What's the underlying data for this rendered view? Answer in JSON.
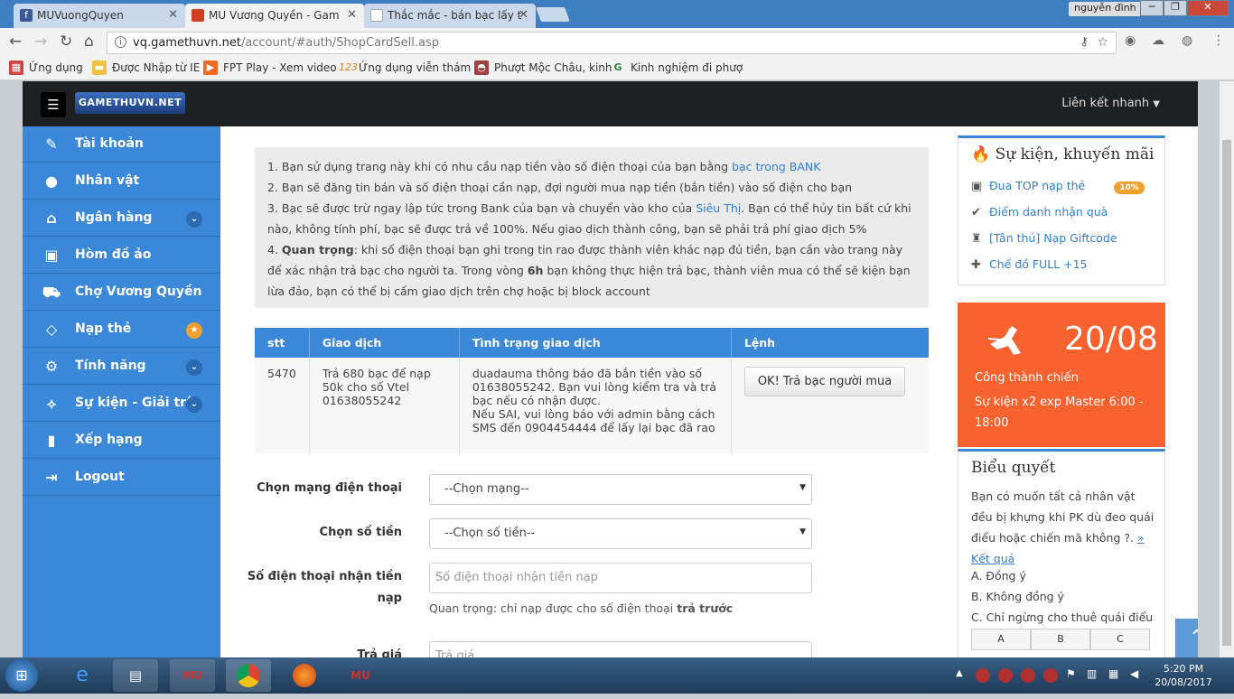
{
  "browser": {
    "tabs": [
      {
        "title": "MUVuongQuyen",
        "icon_color": "#3b5998",
        "icon_letter": "f"
      },
      {
        "title": "MU Vương Quyền - Gam",
        "icon_color": "#d04020",
        "icon_letter": "M"
      },
      {
        "title": "Thắc mắc - bán bạc lấy t",
        "icon_color": "#ffffff",
        "icon_letter": ""
      }
    ],
    "user": "nguyễn đình",
    "url_host": "vq.gamethuvn.net",
    "url_path": "/account/#auth/ShopCardSell.asp",
    "bookmarks": [
      {
        "label": "Ứng dụng",
        "icon": "▦",
        "color": "#cc4444"
      },
      {
        "label": "Được Nhập từ IE",
        "icon": "▬",
        "color": "#f0c040"
      },
      {
        "label": "FPT Play - Xem video",
        "icon": "▶",
        "color": "#f06a20"
      },
      {
        "label": "Ứng dụng viễn thám",
        "icon": "123",
        "color": "#f08020"
      },
      {
        "label": "Phượt Mộc Châu, kinh",
        "icon": "◓",
        "color": "#a04040"
      },
      {
        "label": "Kinh nghiệm đi phượ",
        "icon": "G",
        "color": "#2a8a3a"
      }
    ]
  },
  "header": {
    "logo": "GAMETHUVN.NET",
    "logo_mark": "MU",
    "quick_link": "Liên kết nhanh"
  },
  "sidebar": {
    "items": [
      {
        "label": "Tài khoản",
        "icon": "✎",
        "badge": ""
      },
      {
        "label": "Nhân vật",
        "icon": "●",
        "badge": ""
      },
      {
        "label": "Ngân hàng",
        "icon": "⌂",
        "badge": "⌄"
      },
      {
        "label": "Hòm đồ ảo",
        "icon": "▣",
        "badge": ""
      },
      {
        "label": "Chợ Vương Quyền",
        "icon": "⛟",
        "badge": ""
      },
      {
        "label": "Nạp thẻ",
        "icon": "◇",
        "badge": "★"
      },
      {
        "label": "Tính năng",
        "icon": "⚙",
        "badge": "⌄"
      },
      {
        "label": "Sự kiện - Giải trí",
        "icon": "⟡",
        "badge": "⌄"
      },
      {
        "label": "Xếp hạng",
        "icon": "▮",
        "badge": ""
      },
      {
        "label": "Logout",
        "icon": "⇥",
        "badge": ""
      }
    ]
  },
  "info": {
    "line1": "1. Bạn sử dụng trang này khi có nhu cầu nạp tiền vào số điện thoại của bạn bằng ",
    "line1_link": "bạc trong BANK",
    "line2": "2. Bạn sẽ đăng tin bán và số điện thoại cần nạp, đợi người mua nạp tiền (bắn tiền) vào số điện cho bạn",
    "line3a": "3. Bạc sẽ được trừ ngay lập tức trong Bank của bạn và chuyển vào kho của ",
    "line3_link": "Siêu Thị",
    "line3b": ". Bạn có thể hủy tin bất cứ khi nào, không tính phí, bạc sẽ được trả về 100%. Nếu giao dịch thành công, bạn sẽ phải trả phí giao dịch 5%",
    "line4_prefix": "4. ",
    "line4_bold": "Quan trọng",
    "line4a": ": khi số điện thoại bạn ghi trong tin rao được thành viên khác nạp đủ tiền, bạn cần vào trang này để xác nhận trả bạc cho người ta. Trong vòng ",
    "line4_bold2": "6h",
    "line4b": " bạn không thực hiện trả bạc, thành viên mua có thể sẽ kiện bạn lừa đảo, bạn có thể bị cấm giao dịch trên chợ hoặc bị block account"
  },
  "table": {
    "headers": [
      "stt",
      "Giao dịch",
      "Tình trạng giao dịch",
      "Lệnh"
    ],
    "row": {
      "stt": "5470",
      "deal": "Trả 680 bạc để nạp 50k cho số Vtel 01638055242",
      "status1": "duadauma thông báo đã bắn tiền vào số 01638055242. Bạn vui lòng kiểm tra và trả bạc nếu có nhận được.",
      "status2": "Nếu SAI, vui lòng báo với admin bằng cách SMS đến 0904454444 để lấy lại bạc đã rao",
      "action": "OK! Trả bạc người mua"
    }
  },
  "form": {
    "network_label": "Chọn mạng điện thoại",
    "network_value": "--Chọn mạng--",
    "amount_label": "Chọn số tiền",
    "amount_value": "--Chọn số tiền--",
    "phone_label": "Số điện thoại nhận tiền nạp",
    "phone_placeholder": "Số điện thoại nhận tiền nạp",
    "note_prefix": "Quan trọng: chỉ nạp được cho số điện thoại ",
    "note_bold": "trả trước",
    "price_label": "Trả giá",
    "price_placeholder": "Trả giá"
  },
  "events": {
    "title": "Sự kiện, khuyến mãi",
    "items": [
      {
        "label": "Đua TOP nạp thẻ",
        "icon": "▣",
        "badge": "10%"
      },
      {
        "label": "Điểm danh nhận quà",
        "icon": "✔",
        "badge": ""
      },
      {
        "label": "[Tân thủ] Nạp Giftcode",
        "icon": "♜",
        "badge": ""
      },
      {
        "label": "Chế đồ FULL +15",
        "icon": "✚",
        "badge": ""
      }
    ]
  },
  "castle": {
    "date": "20/08",
    "title": "Công thành chiến",
    "detail": "Sự kiện x2 exp Master 6:00 - 18:00"
  },
  "poll": {
    "title": "Biểu quyết",
    "question": "Bạn có muốn tất cả nhân vật đều bị khựng khi PK dù đeo quái điểu hoặc chiến mã không ?.",
    "result_link": "» Kết quả",
    "options": [
      "A. Đồng ý",
      "B. Không đồng ý",
      "C. Chỉ ngừng cho thuê quái điểu"
    ],
    "buttons": [
      "A",
      "B",
      "C"
    ]
  },
  "taskbar": {
    "time": "5:20 PM",
    "date": "20/08/2017"
  }
}
